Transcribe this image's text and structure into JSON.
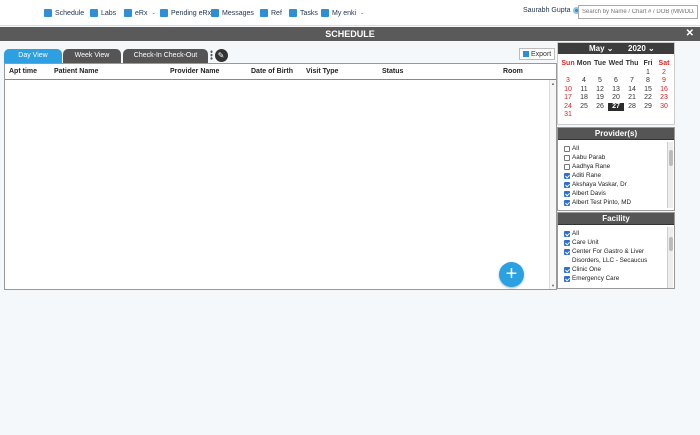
{
  "nav": {
    "items": [
      {
        "label": "Schedule",
        "icon": "calendar-icon",
        "dropdown": false
      },
      {
        "label": "Labs",
        "icon": "flask-icon",
        "dropdown": false
      },
      {
        "label": "eRx",
        "icon": "prescription-icon",
        "dropdown": true
      },
      {
        "label": "Pending eRx",
        "icon": "pending-prescription-icon",
        "dropdown": false
      },
      {
        "label": "Messages",
        "icon": "envelope-icon",
        "dropdown": false
      },
      {
        "label": "Ref",
        "icon": "referral-icon",
        "dropdown": false
      },
      {
        "label": "Tasks",
        "icon": "checklist-icon",
        "dropdown": false
      },
      {
        "label": "My enki",
        "icon": "stethoscope-icon",
        "dropdown": true
      }
    ],
    "user": "Saurabh Gupta",
    "search_placeholder": "Search by Name / Chart # / DOB (MM/DD/YYYY)"
  },
  "title": "SCHEDULE",
  "tabs": [
    "Day View",
    "Week View",
    "Check-In Check-Out"
  ],
  "export_label": "Export",
  "table": {
    "columns": [
      "Apt time",
      "Patient Name",
      "Provider Name",
      "Date of Birth",
      "Visit Type",
      "Status",
      "Room"
    ],
    "rows": []
  },
  "calendar": {
    "month": "May",
    "year": "2020",
    "weekdays": [
      "Sun",
      "Mon",
      "Tue",
      "Wed",
      "Thu",
      "Fri",
      "Sat"
    ],
    "weeks": [
      [
        "",
        "",
        "",
        "",
        "",
        "1",
        "2"
      ],
      [
        "3",
        "4",
        "5",
        "6",
        "7",
        "8",
        "9"
      ],
      [
        "10",
        "11",
        "12",
        "13",
        "14",
        "15",
        "16"
      ],
      [
        "17",
        "18",
        "19",
        "20",
        "21",
        "22",
        "23"
      ],
      [
        "24",
        "25",
        "26",
        "27",
        "28",
        "29",
        "30"
      ],
      [
        "31",
        "",
        "",
        "",
        "",
        "",
        ""
      ]
    ],
    "selected": "27",
    "weekend_color": "#d22222"
  },
  "providers": {
    "title": "Provider(s)",
    "items": [
      {
        "label": "All",
        "checked": false
      },
      {
        "label": "Aabu Parab",
        "checked": false
      },
      {
        "label": "Aadhya Rane",
        "checked": false
      },
      {
        "label": "Aditi Rane",
        "checked": true
      },
      {
        "label": "Akshaya Vaskar, Dr",
        "checked": true
      },
      {
        "label": "Albert Davis",
        "checked": true
      },
      {
        "label": "Albert Test Pinto, MD",
        "checked": true
      }
    ]
  },
  "facility": {
    "title": "Facility",
    "items": [
      {
        "label": "All",
        "checked": true
      },
      {
        "label": "Care Unit",
        "checked": true
      },
      {
        "label": "Center For Gastro & Liver Disorders, LLC - Secaucus",
        "checked": true
      },
      {
        "label": "Clinic One",
        "checked": true
      },
      {
        "label": "Emergency Care",
        "checked": true
      }
    ]
  },
  "colors": {
    "accent": "#2e9fe0",
    "titlebar": "#5a5a5a",
    "fab": "#2aa1e3"
  }
}
